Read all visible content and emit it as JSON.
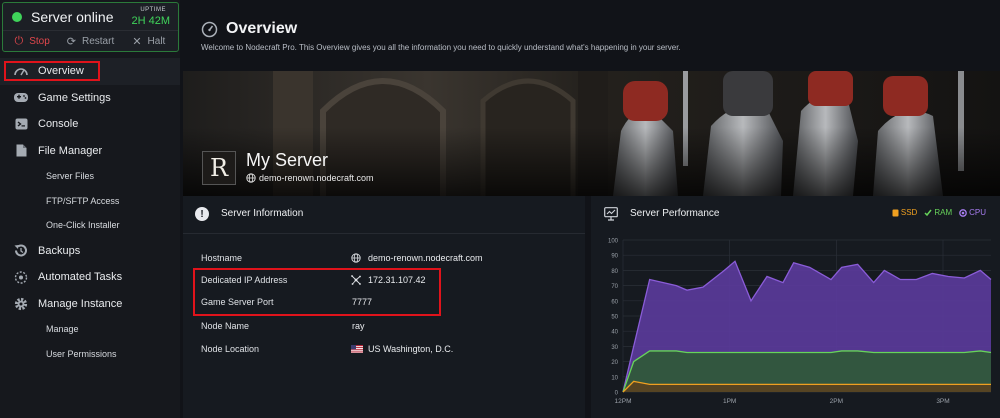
{
  "status": {
    "label": "Server online",
    "uptime_label": "UPTIME",
    "uptime_value": "2H 42M",
    "stop_label": "Stop",
    "restart_label": "Restart",
    "halt_label": "Halt",
    "online_color": "#3fd35a"
  },
  "nav": {
    "items": [
      {
        "label": "Overview",
        "icon": "speedometer-icon"
      },
      {
        "label": "Game Settings",
        "icon": "gamepad-icon"
      },
      {
        "label": "Console",
        "icon": "terminal-icon"
      },
      {
        "label": "File Manager",
        "icon": "file-icon"
      },
      {
        "label": "Server Files"
      },
      {
        "label": "FTP/SFTP Access"
      },
      {
        "label": "One-Click Installer"
      },
      {
        "label": "Backups",
        "icon": "backup-icon"
      },
      {
        "label": "Automated Tasks",
        "icon": "tasks-icon"
      },
      {
        "label": "Manage Instance",
        "icon": "gear-icon"
      },
      {
        "label": "Manage"
      },
      {
        "label": "User Permissions"
      }
    ]
  },
  "header": {
    "title": "Overview",
    "subtitle": "Welcome to Nodecraft Pro. This Overview gives you all the information you need to quickly understand what's happening in your server."
  },
  "banner": {
    "logo_letter": "R",
    "server_name": "My Server",
    "host": "demo-renown.nodecraft.com"
  },
  "info": {
    "title": "Server Information",
    "rows": [
      {
        "label": "Hostname",
        "value": "demo-renown.nodecraft.com"
      },
      {
        "label": "Dedicated IP Address",
        "value": "172.31.107.42"
      },
      {
        "label": "Game Server Port",
        "value": "7777"
      },
      {
        "label": "Node Name",
        "value": "ray"
      },
      {
        "label": "Node Location",
        "value": "US Washington, D.C."
      }
    ]
  },
  "perf": {
    "title": "Server Performance",
    "legend": [
      {
        "label": "SSD",
        "color": "#f0a020"
      },
      {
        "label": "RAM",
        "color": "#67d35a"
      },
      {
        "label": "CPU",
        "color": "#8a5cd8"
      }
    ]
  },
  "chart_data": {
    "type": "area",
    "title": "",
    "xlabel": "",
    "ylabel": "",
    "ylim": [
      0,
      100
    ],
    "yticks": [
      0,
      10,
      20,
      30,
      40,
      50,
      60,
      70,
      80,
      90,
      100
    ],
    "xtick_labels": [
      "12PM",
      "1PM",
      "2PM",
      "3PM"
    ],
    "grid": true,
    "legend_position": "top-right",
    "x": [
      0,
      0.1,
      0.25,
      0.5,
      0.6,
      0.75,
      0.95,
      1.05,
      1.2,
      1.35,
      1.5,
      1.6,
      1.75,
      1.95,
      2.05,
      2.2,
      2.35,
      2.45,
      2.6,
      2.75,
      2.9,
      3.05,
      3.2,
      3.35,
      3.45
    ],
    "series": [
      {
        "name": "CPU",
        "color": "#8a5cd8",
        "values": [
          0,
          30,
          74,
          70,
          67,
          69,
          80,
          86,
          60,
          76,
          72,
          85,
          82,
          74,
          82,
          84,
          72,
          80,
          74,
          74,
          78,
          76,
          75,
          80,
          74
        ]
      },
      {
        "name": "RAM",
        "color": "#67d35a",
        "values": [
          0,
          20,
          27,
          27,
          26,
          26,
          26,
          26,
          26,
          26,
          26,
          26,
          26,
          26,
          27,
          27,
          26,
          26,
          26,
          26,
          26,
          26,
          26,
          27,
          26
        ]
      },
      {
        "name": "SSD",
        "color": "#f0a020",
        "values": [
          0,
          7,
          5,
          5,
          5,
          5,
          5,
          5,
          5,
          5,
          5,
          5,
          5,
          5,
          5,
          5,
          5,
          5,
          5,
          5,
          5,
          5,
          5,
          5,
          5
        ]
      }
    ]
  }
}
